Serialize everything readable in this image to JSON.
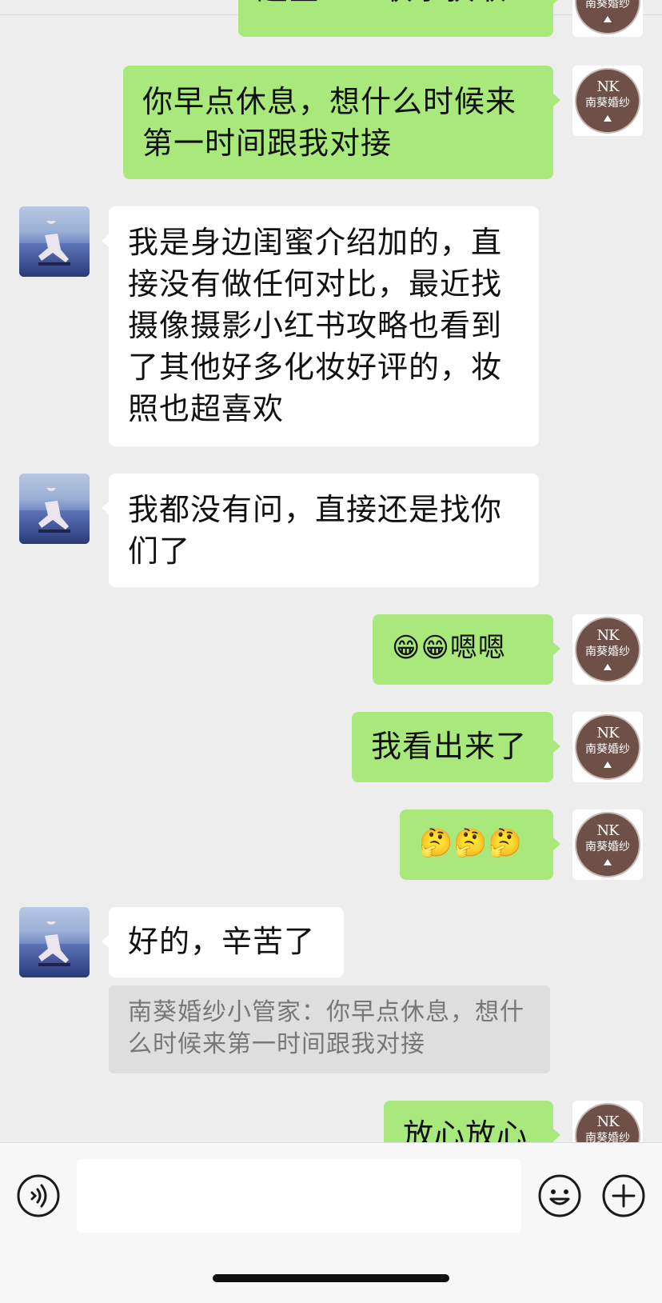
{
  "messages": [
    {
      "side": "out",
      "text": "超全……联系获取"
    },
    {
      "side": "out",
      "text": "你早点休息，想什么时候来第一时间跟我对接"
    },
    {
      "side": "in",
      "text": "我是身边闺蜜介绍加的，直接没有做任何对比，最近找摄像摄影小红书攻略也看到了其他好多化妆好评的，妆照也超喜欢"
    },
    {
      "side": "in",
      "text": "我都没有问，直接还是找你们了"
    },
    {
      "side": "out",
      "text": "😁😁嗯嗯"
    },
    {
      "side": "out",
      "text": "我看出来了"
    },
    {
      "side": "out",
      "text": "🤔🤔🤔"
    },
    {
      "side": "in",
      "text": "好的，辛苦了"
    },
    {
      "side": "out",
      "text": "放心放心"
    }
  ],
  "quote": {
    "text": "南葵婚纱小管家：你早点休息，想什么时候来第一时间跟我对接"
  },
  "shop_avatar": {
    "monogram": "NK",
    "name": "南葵婚纱",
    "color": "#6e5048"
  },
  "colors": {
    "background": "#ededed",
    "outgoing_bubble": "#a9e97b",
    "incoming_bubble": "#ffffff"
  },
  "input_bar": {
    "voice_icon": "voice-icon",
    "emoji_icon": "smiley-icon",
    "plus_icon": "plus-icon",
    "text": ""
  }
}
